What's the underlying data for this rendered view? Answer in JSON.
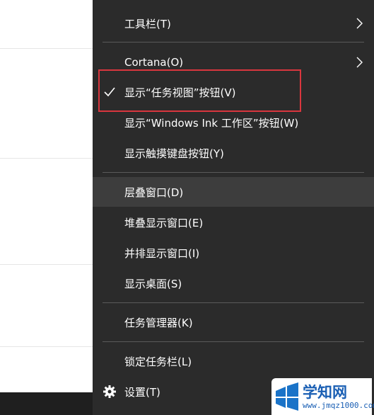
{
  "menu": {
    "items": [
      {
        "label": "工具栏(T)",
        "submenu": true
      },
      {
        "label": "Cortana(O)",
        "submenu": true
      },
      {
        "label": "显示“任务视图”按钮(V)",
        "checked": true
      },
      {
        "label": "显示“Windows Ink 工作区”按钮(W)"
      },
      {
        "label": "显示触摸键盘按钮(Y)"
      },
      {
        "label": "层叠窗口(D)",
        "hovered": true
      },
      {
        "label": "堆叠显示窗口(E)"
      },
      {
        "label": "并排显示窗口(I)"
      },
      {
        "label": "显示桌面(S)"
      },
      {
        "label": "任务管理器(K)"
      },
      {
        "label": "锁定任务栏(L)"
      },
      {
        "label": "设置(T)",
        "icon": "gear-icon"
      }
    ]
  },
  "watermark": {
    "brand": "学知网",
    "url": "www.jmqz1000.com"
  },
  "colors": {
    "menu_bg": "#2b2b2b",
    "hover_bg": "#3d3d3d",
    "highlight_border": "#d9363e",
    "watermark_blue": "#1a5fb4"
  }
}
